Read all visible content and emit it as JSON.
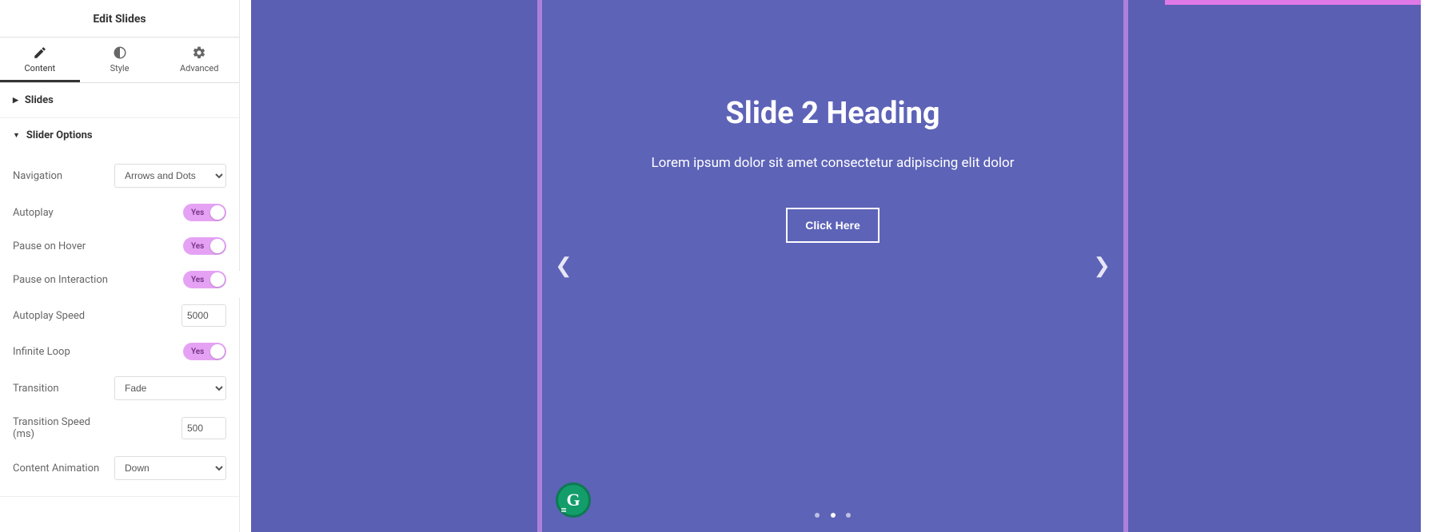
{
  "header": {
    "title": "Edit Slides"
  },
  "tabs": {
    "content": "Content",
    "style": "Style",
    "advanced": "Advanced"
  },
  "sections": {
    "slides": "Slides",
    "slider_options": "Slider Options"
  },
  "options": {
    "navigation_label": "Navigation",
    "navigation_value": "Arrows and Dots",
    "autoplay_label": "Autoplay",
    "pause_hover_label": "Pause on Hover",
    "pause_interaction_label": "Pause on Interaction",
    "autoplay_speed_label": "Autoplay Speed",
    "autoplay_speed_value": "5000",
    "infinite_loop_label": "Infinite Loop",
    "transition_label": "Transition",
    "transition_value": "Fade",
    "transition_speed_label": "Transition Speed (ms)",
    "transition_speed_value": "500",
    "content_animation_label": "Content Animation",
    "content_animation_value": "Down",
    "toggle_yes": "Yes"
  },
  "slide": {
    "heading": "Slide 2 Heading",
    "body": "Lorem ipsum dolor sit amet consectetur adipiscing elit dolor",
    "cta": "Click Here"
  },
  "badge": {
    "letter": "G"
  }
}
